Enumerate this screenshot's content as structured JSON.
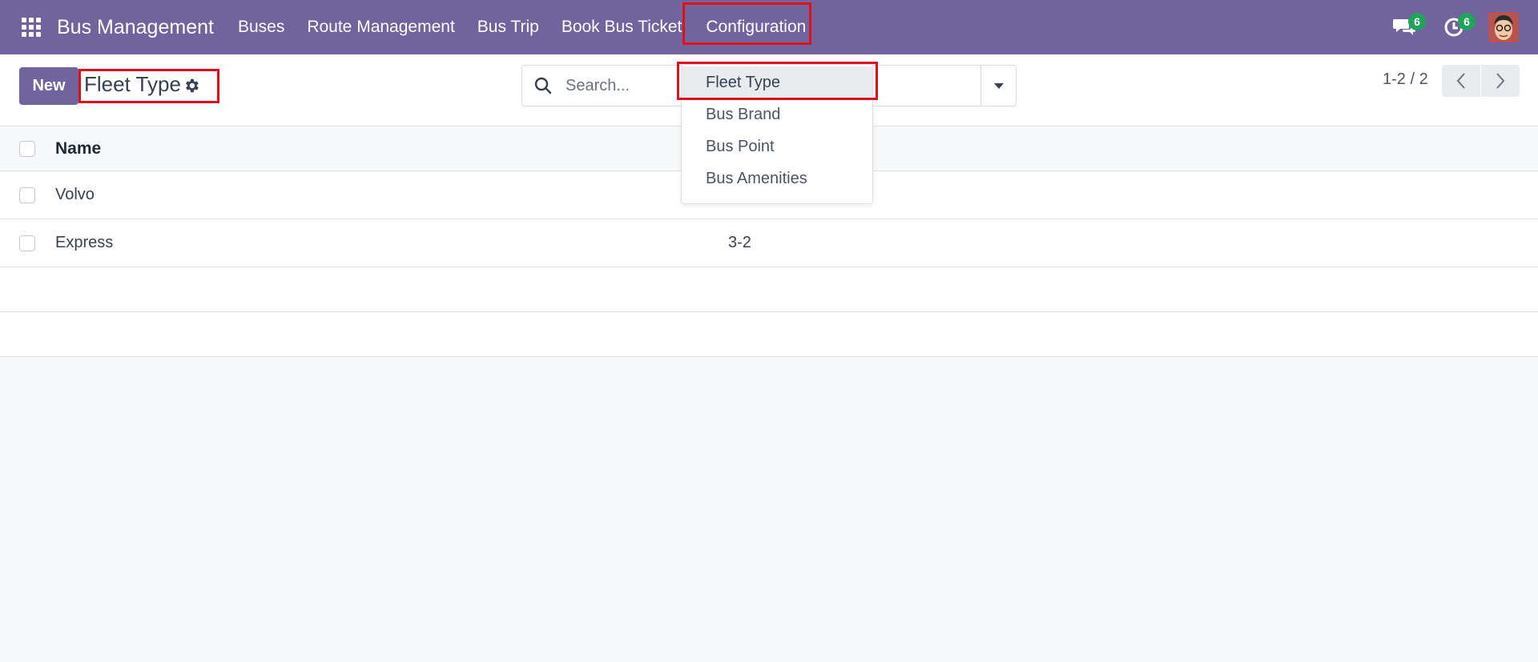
{
  "navbar": {
    "app_title": "Bus Management",
    "menu": [
      {
        "label": "Buses"
      },
      {
        "label": "Route Management"
      },
      {
        "label": "Bus Trip"
      },
      {
        "label": "Book Bus Ticket"
      },
      {
        "label": "Configuration"
      }
    ],
    "messages_count": "6",
    "activities_count": "6",
    "icons": [
      "apps-grid-icon",
      "chat-icon",
      "clock-icon",
      "avatar"
    ],
    "brand_color": "#71639e"
  },
  "configuration_menu": {
    "items": [
      {
        "label": "Fleet Type"
      },
      {
        "label": "Bus Brand"
      },
      {
        "label": "Bus Point"
      },
      {
        "label": "Bus Amenities"
      }
    ]
  },
  "control_panel": {
    "new_label": "New",
    "title": "Fleet Type",
    "search_placeholder": "Search...",
    "pager": "1-2 / 2"
  },
  "list": {
    "header_name": "Name",
    "rows": [
      {
        "name": "Volvo",
        "layout": ""
      },
      {
        "name": "Express",
        "layout": "3-2"
      }
    ]
  },
  "highlight_color": "#e0101a"
}
